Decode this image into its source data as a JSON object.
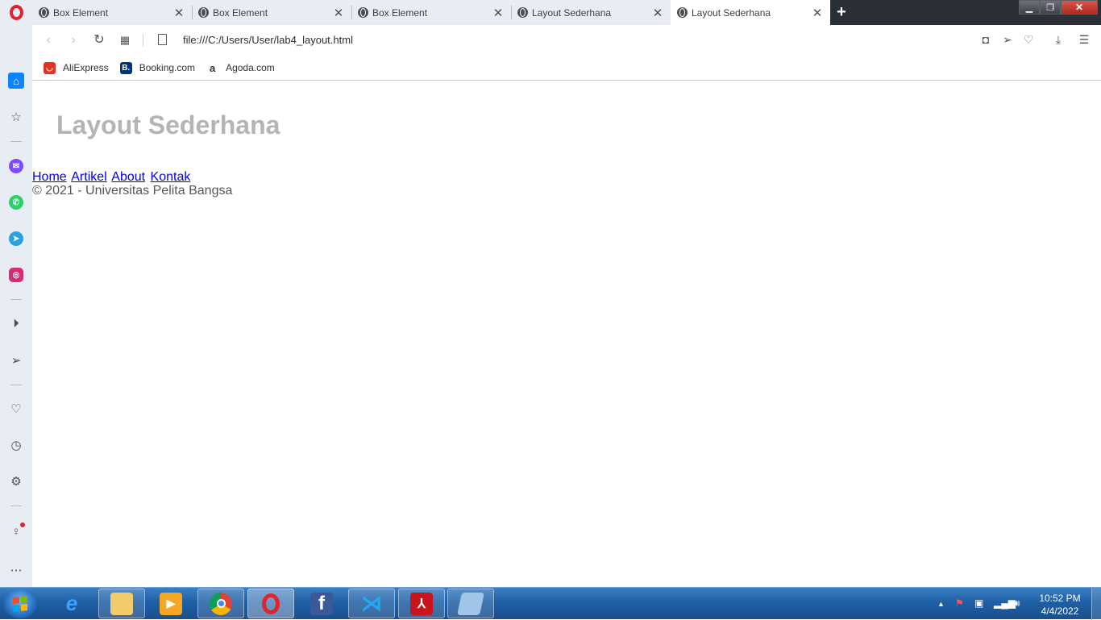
{
  "tabs": [
    {
      "title": "Box Element",
      "active": false
    },
    {
      "title": "Box Element",
      "active": false
    },
    {
      "title": "Box Element",
      "active": false
    },
    {
      "title": "Layout Sederhana",
      "active": false
    },
    {
      "title": "Layout Sederhana",
      "active": true
    }
  ],
  "address_bar": {
    "url": "file:///C:/Users/User/lab4_layout.html"
  },
  "bookmarks": [
    {
      "label": "AliExpress",
      "color": "#e43225"
    },
    {
      "label": "Booking.com",
      "color": "#003580"
    },
    {
      "label": "Agoda.com",
      "color": "#ffffff"
    }
  ],
  "page": {
    "heading": "Layout Sederhana",
    "nav_links": [
      "Home",
      "Artikel",
      "About",
      "Kontak"
    ],
    "footer": "© 2021 - Universitas Pelita Bangsa"
  },
  "taskbar": {
    "time": "10:52 PM",
    "date": "4/4/2022"
  },
  "colors": {
    "accent": "#0a84ff",
    "opera_red": "#e0242e",
    "link": "#0000ee",
    "heading_gray": "#b4b4b4"
  }
}
